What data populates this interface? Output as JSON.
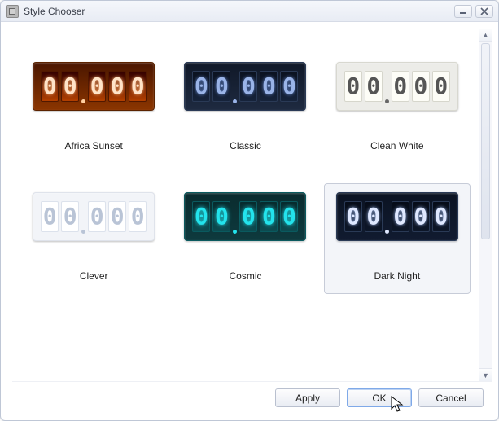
{
  "window": {
    "title": "Style Chooser"
  },
  "styles": [
    {
      "label": "Africa Sunset",
      "key": "africa",
      "selected": false
    },
    {
      "label": "Classic",
      "key": "classic",
      "selected": false
    },
    {
      "label": "Clean White",
      "key": "cleanwhite",
      "selected": false
    },
    {
      "label": "Clever",
      "key": "clever",
      "selected": false
    },
    {
      "label": "Cosmic",
      "key": "cosmic",
      "selected": false
    },
    {
      "label": "Dark Night",
      "key": "darknight",
      "selected": true
    }
  ],
  "digits": [
    "0",
    "0",
    "0",
    "0",
    "0"
  ],
  "buttons": {
    "apply": "Apply",
    "ok": "OK",
    "cancel": "Cancel"
  }
}
